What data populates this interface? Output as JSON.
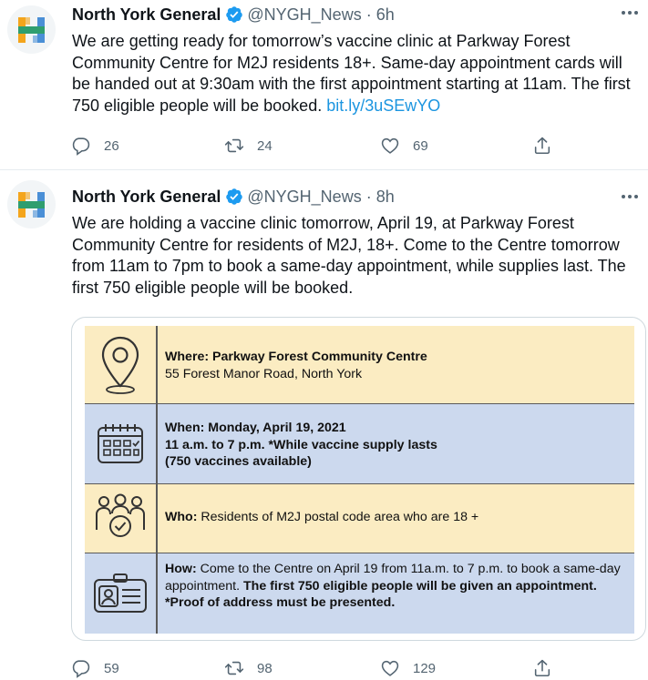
{
  "tweets": [
    {
      "author_name": "North York General",
      "handle": "@NYGH_News",
      "separator": "·",
      "time": "6h",
      "text": "We are getting ready for tomorrow’s vaccine clinic at Parkway Forest Community Centre for M2J residents 18+. Same-day appointment cards will be handed out at 9:30am with the first appointment starting at 11am. The first 750 eligible people will be booked. ",
      "link": "bit.ly/3uSEwYO",
      "replies": "26",
      "retweets": "24",
      "likes": "69"
    },
    {
      "author_name": "North York General",
      "handle": "@NYGH_News",
      "separator": "·",
      "time": "8h",
      "text": "We are holding a vaccine clinic tomorrow, April 19, at Parkway Forest Community Centre for residents of M2J, 18+. Come to the Centre tomorrow from 11am to 7pm to book a same-day appointment, while supplies last. The first 750 eligible people will be booked.",
      "replies": "59",
      "retweets": "98",
      "likes": "129"
    }
  ],
  "infographic": {
    "where_label": "Where: Parkway Forest Community Centre",
    "where_address": "55 Forest Manor Road, North York",
    "when_label": "When: Monday, April 19, 2021",
    "when_hours": "11 a.m. to 7 p.m. *While vaccine supply lasts",
    "when_note": "(750 vaccines available)",
    "who_label": "Who:",
    "who_text": " Residents of M2J postal code area who are 18 +",
    "how_label": "How:",
    "how_text": " Come to the Centre on April 19 from 11a.m. to 7 p.m. to book a same-day appointment. ",
    "how_bold": "The first 750 eligible people will be given an appointment.",
    "how_proof": " *Proof of address must be presented."
  },
  "colors": {
    "accent": "#1b95e0",
    "verified": "#1d9bf0",
    "muted": "#536471",
    "infographic_yellow": "#fbecc2",
    "infographic_blue": "#ccd9ee"
  },
  "icons": {
    "more": "more-icon",
    "verified": "verified-badge-icon",
    "reply": "reply-icon",
    "retweet": "retweet-icon",
    "like": "heart-icon",
    "share": "share-icon",
    "where": "location-pin-icon",
    "when": "calendar-icon",
    "who": "people-check-icon",
    "how": "id-card-icon"
  }
}
